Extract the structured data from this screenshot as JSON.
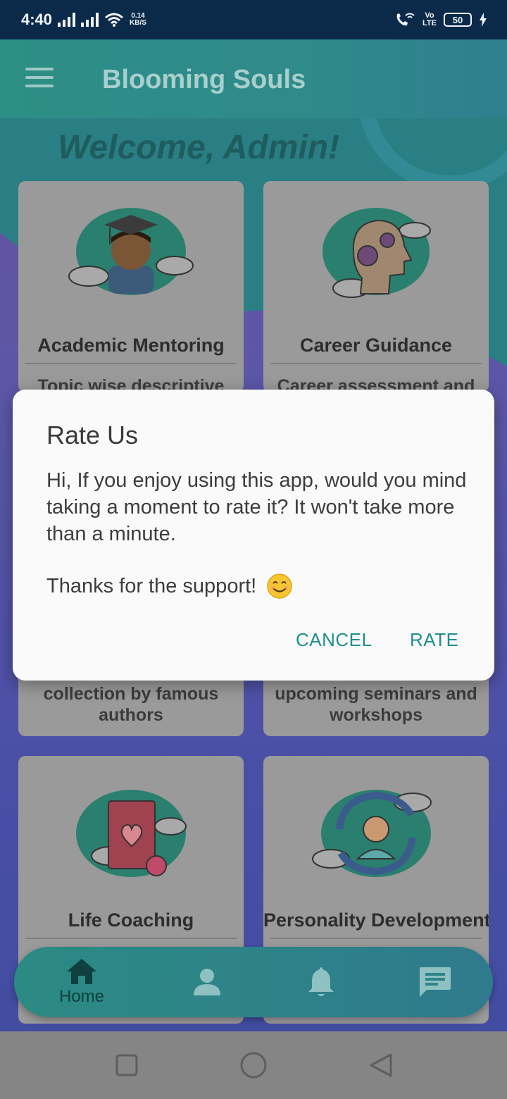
{
  "status_bar": {
    "time": "4:40",
    "speed_value": "0.14",
    "speed_unit": "KB/S",
    "volte_top": "Vo",
    "volte_bottom": "LTE",
    "battery": "50"
  },
  "app_bar": {
    "title": "Blooming Souls",
    "menu_icon": "hamburger-icon"
  },
  "welcome": "Welcome, Admin!",
  "cards": [
    {
      "title": "Academic Mentoring",
      "description_partial": "Topic wise descriptive",
      "icon": "graduate-icon"
    },
    {
      "title": "Career Guidance",
      "description_partial": "Career assessment and",
      "icon": "head-gears-icon"
    },
    {
      "title": "",
      "description_partial": "collection by famous authors",
      "icon": ""
    },
    {
      "title": "",
      "description_partial": "upcoming seminars and workshops",
      "icon": ""
    },
    {
      "title": "Life Coaching",
      "description_partial": "",
      "icon": "book-heart-icon"
    },
    {
      "title": "Personality Development",
      "description_partial": "",
      "icon": "person-cycle-icon"
    }
  ],
  "dialog": {
    "title": "Rate Us",
    "message": "Hi, If you enjoy using this app, would you mind taking a moment to rate it? It won't take more than a minute.",
    "thanks": "Thanks for the support!",
    "cancel_label": "CANCEL",
    "rate_label": "RATE"
  },
  "bottom_nav": {
    "items": [
      {
        "label": "Home",
        "icon": "home-icon",
        "active": true
      },
      {
        "label": "",
        "icon": "profile-icon",
        "active": false
      },
      {
        "label": "",
        "icon": "bell-icon",
        "active": false
      },
      {
        "label": "",
        "icon": "chat-icon",
        "active": false
      }
    ]
  },
  "system_nav": [
    "recents-icon",
    "home-circle-icon",
    "back-icon"
  ],
  "colors": {
    "accent": "#1f8f8c",
    "app_bar": "#2d8f86",
    "dialog_bg": "#fafafa"
  }
}
